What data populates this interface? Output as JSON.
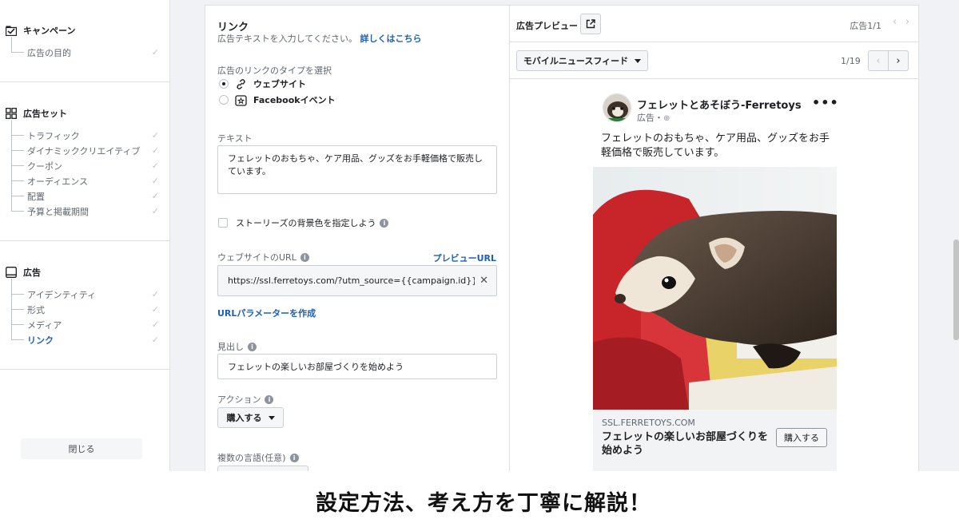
{
  "sidebar": {
    "campaign": {
      "title": "キャンペーン",
      "items": [
        "広告の目的"
      ]
    },
    "adset": {
      "title": "広告セット",
      "items": [
        "トラフィック",
        "ダイナミッククリエイティブ",
        "クーポン",
        "オーディエンス",
        "配置",
        "予算と掲載期間"
      ]
    },
    "ad": {
      "title": "広告",
      "items": [
        "アイデンティティ",
        "形式",
        "メディア",
        "リンク"
      ]
    },
    "close_label": "閉じる"
  },
  "editor": {
    "title": "リンク",
    "subtitle": "広告テキストを入力してください。",
    "learn_more": "詳しくはこちら",
    "link_type_label": "広告のリンクのタイプを選択",
    "link_types": [
      "ウェブサイト",
      "Facebookイベント"
    ],
    "text_label": "テキスト",
    "text_value": "フェレットのおもちゃ、ケア用品、グッズをお手軽価格で販売しています。",
    "story_bg_label": "ストーリーズの背景色を指定しよう",
    "url_label": "ウェブサイトのURL",
    "preview_url": "プレビューURL",
    "url_value": "https://ssl.ferretoys.com/?utm_source={{campaign.id}}&utm_medium",
    "url_params": "URLパラメーターを作成",
    "headline_label": "見出し",
    "headline_value": "フェレットの楽しいお部屋づくりを始めよう",
    "action_label": "アクション",
    "action_value": "購入する",
    "languages_label": "複数の言語(任意)"
  },
  "preview": {
    "title": "広告プレビュー",
    "ad_count": "広告1/1",
    "placement": "モバイルニュースフィード",
    "page_count": "1/19",
    "page_name": "フェレットとあそぼう-Ferretoys",
    "sponsored": "広告・",
    "primary_text": "フェレットのおもちゃ、ケア用品、グッズをお手軽価格で販売しています。",
    "domain": "SSL.FERRETOYS.COM",
    "headline": "フェレットの楽しいお部屋づくりを始めよう",
    "cta": "購入する"
  },
  "caption": "設定方法、考え方を丁寧に解説！",
  "colors": {
    "link": "#1d5fba",
    "border": "#dddfe2",
    "panel_bg": "#f0f2f5"
  }
}
